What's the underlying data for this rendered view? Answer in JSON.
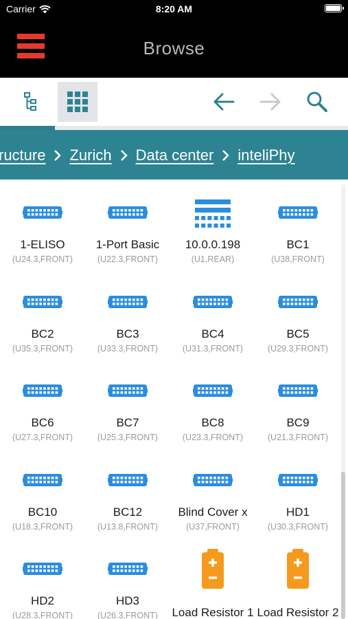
{
  "status_bar": {
    "carrier": "Carrier",
    "time": "8:20 AM"
  },
  "header": {
    "title": "Browse"
  },
  "toolbar": {
    "buttons": [
      {
        "name": "tree-view",
        "icon": "tree-icon",
        "active": false
      },
      {
        "name": "grid-view",
        "icon": "grid-icon",
        "active": true
      },
      {
        "name": "back",
        "icon": "arrow-left-icon",
        "enabled": true
      },
      {
        "name": "forward",
        "icon": "arrow-right-icon",
        "enabled": false
      },
      {
        "name": "search",
        "icon": "search-icon",
        "enabled": true
      }
    ]
  },
  "breadcrumb": {
    "items": [
      "ructure",
      "Zurich",
      "Data center",
      "inteliPhy"
    ]
  },
  "colors": {
    "accent": "#2d8391",
    "icon_blue": "#2b8de0",
    "battery_orange": "#f59a1d",
    "menu_red": "#e53a2b"
  },
  "items": [
    {
      "name": "1-ELISO",
      "location": "(U24.3,FRONT)",
      "icon": "patch-panel-icon"
    },
    {
      "name": "1-Port Basic",
      "location": "(U22.3,FRONT)",
      "icon": "patch-panel-icon"
    },
    {
      "name": "10.0.0.198",
      "location": "(U1,REAR)",
      "icon": "switch-icon"
    },
    {
      "name": "BC1",
      "location": "(U38,FRONT)",
      "icon": "patch-panel-icon"
    },
    {
      "name": "BC2",
      "location": "(U35.3,FRONT)",
      "icon": "patch-panel-icon"
    },
    {
      "name": "BC3",
      "location": "(U33.3,FRONT)",
      "icon": "patch-panel-icon"
    },
    {
      "name": "BC4",
      "location": "(U31.3,FRONT)",
      "icon": "patch-panel-icon"
    },
    {
      "name": "BC5",
      "location": "(U29.3,FRONT)",
      "icon": "patch-panel-icon"
    },
    {
      "name": "BC6",
      "location": "(U27.3,FRONT)",
      "icon": "patch-panel-icon"
    },
    {
      "name": "BC7",
      "location": "(U25.3,FRONT)",
      "icon": "patch-panel-icon"
    },
    {
      "name": "BC8",
      "location": "(U23.3,FRONT)",
      "icon": "patch-panel-icon"
    },
    {
      "name": "BC9",
      "location": "(U21.3,FRONT)",
      "icon": "patch-panel-icon"
    },
    {
      "name": "BC10",
      "location": "(U18.3,FRONT)",
      "icon": "patch-panel-icon"
    },
    {
      "name": "BC12",
      "location": "(U13.8,FRONT)",
      "icon": "patch-panel-icon"
    },
    {
      "name": "Blind Cover x",
      "location": "(U37,FRONT)",
      "icon": "patch-panel-icon"
    },
    {
      "name": "HD1",
      "location": "(U30.3,FRONT)",
      "icon": "patch-panel-icon"
    },
    {
      "name": "HD2",
      "location": "(U28.3,FRONT)",
      "icon": "patch-panel-icon"
    },
    {
      "name": "HD3",
      "location": "(U26.3,FRONT)",
      "icon": "patch-panel-icon"
    },
    {
      "name": "Load Resistor 1",
      "location": "",
      "icon": "battery-icon"
    },
    {
      "name": "Load Resistor 2",
      "location": "",
      "icon": "battery-icon"
    }
  ]
}
